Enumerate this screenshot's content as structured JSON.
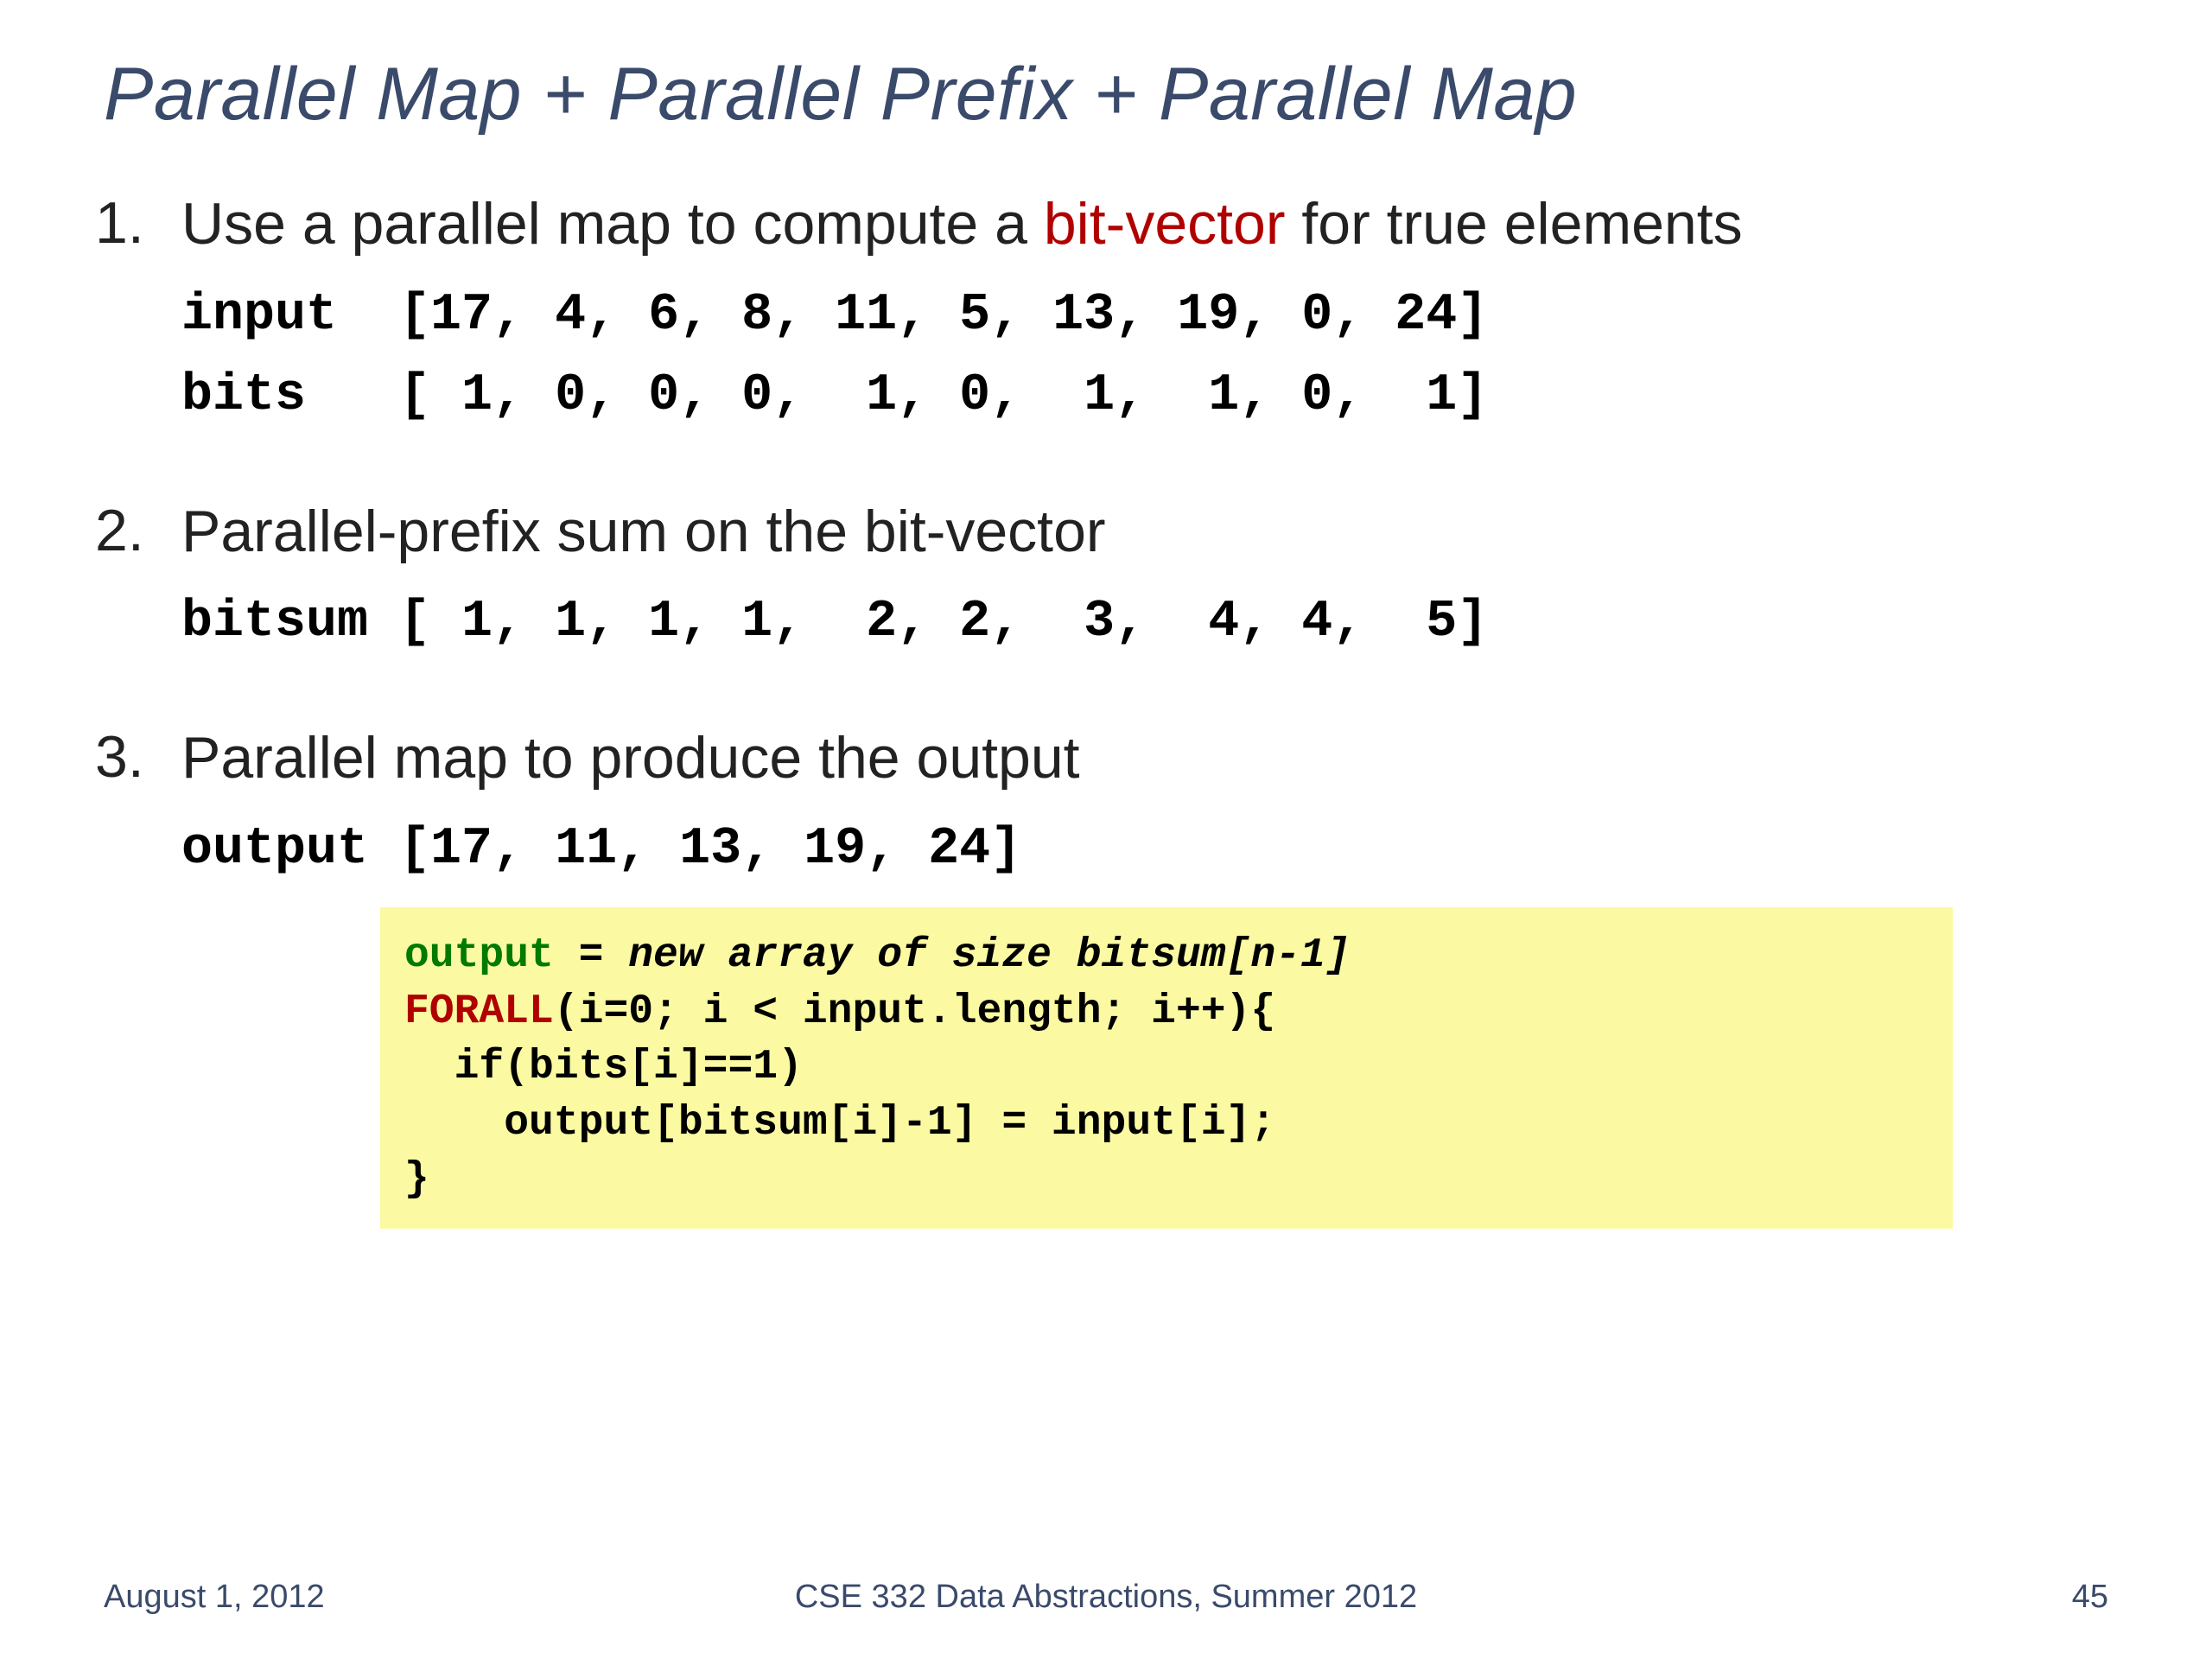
{
  "title": "Parallel Map + Parallel Prefix + Parallel Map",
  "steps": [
    {
      "text_before": "Use a parallel map to compute a ",
      "highlight": "bit-vector",
      "text_after": " for true elements",
      "mono_lines": [
        "input  [17, 4, 6, 8, 11, 5, 13, 19, 0, 24]",
        "bits   [ 1, 0, 0, 0,  1, 0,  1,  1, 0,  1]"
      ]
    },
    {
      "text_before": "Parallel-prefix sum on the bit-vector",
      "highlight": "",
      "text_after": "",
      "mono_lines": [
        "bitsum [ 1, 1, 1, 1,  2, 2,  3,  4, 4,  5]"
      ]
    },
    {
      "text_before": "Parallel map to produce the output",
      "highlight": "",
      "text_after": "",
      "mono_lines": [
        "output [17, 11, 13, 19, 24]"
      ]
    }
  ],
  "code": {
    "kw_output": "output",
    "eq": " = ",
    "new_array": "new array of size bitsum[n-1]",
    "kw_forall": "FORALL",
    "forall_rest": "(i=0; i < input.length; i++){",
    "line_if": "  if(bits[i]==1)",
    "line_asgn": "    output[bitsum[i]-1] = input[i];",
    "line_close": "}"
  },
  "footer": {
    "left": "August 1, 2012",
    "center": "CSE 332 Data Abstractions, Summer 2012",
    "right": "45"
  }
}
